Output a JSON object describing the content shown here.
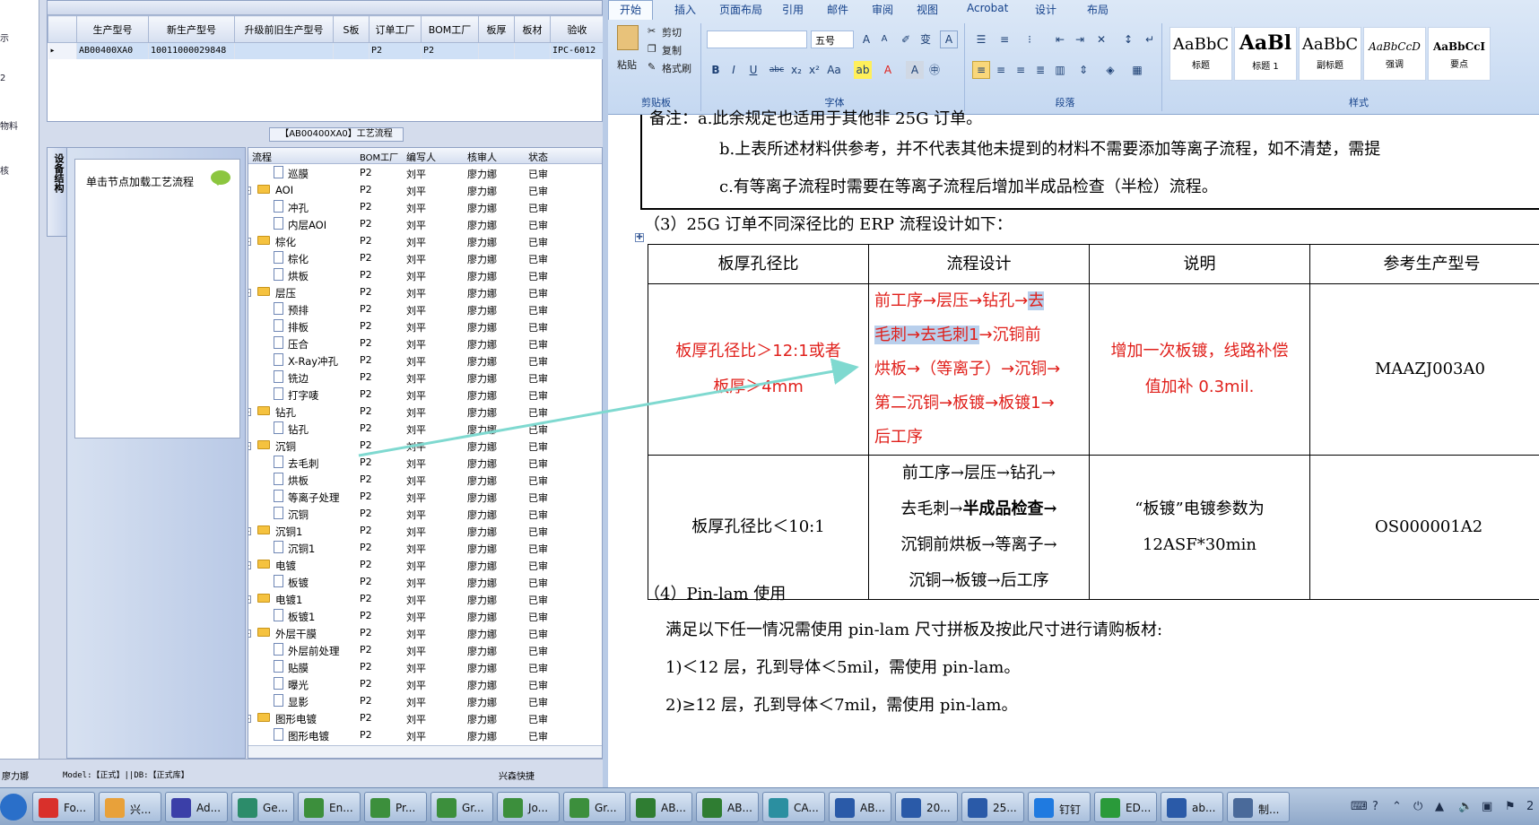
{
  "erp": {
    "sidebar_items": [
      "示",
      "2",
      "物料",
      "核"
    ],
    "grid_columns": [
      "生产型号",
      "新生产型号",
      "升级前旧生产型号",
      "S板",
      "订单工厂",
      "BOM工厂",
      "板厚",
      "板材",
      "验收"
    ],
    "grid_row": [
      "AB00400XA0",
      "10011000029848",
      "",
      "",
      "P2",
      "P2",
      "",
      "",
      "IPC-6012"
    ],
    "flow_caption": "【AB00400XA0】工艺流程",
    "vertical_tab": "设备结构",
    "node_hint": "单击节点加载工艺流程",
    "tree_columns": [
      "流程",
      "BOM工厂",
      "编写人",
      "核审人",
      "状态"
    ],
    "tree_rows": [
      {
        "name": "巡膜",
        "level": 1,
        "factory": "P2",
        "author": "刘平",
        "reviewer": "廖力娜",
        "status": "已审"
      },
      {
        "name": "AOI",
        "level": 0,
        "factory": "P2",
        "author": "刘平",
        "reviewer": "廖力娜",
        "status": "已审"
      },
      {
        "name": "冲孔",
        "level": 1,
        "factory": "P2",
        "author": "刘平",
        "reviewer": "廖力娜",
        "status": "已审"
      },
      {
        "name": "内层AOI",
        "level": 1,
        "factory": "P2",
        "author": "刘平",
        "reviewer": "廖力娜",
        "status": "已审"
      },
      {
        "name": "棕化",
        "level": 0,
        "factory": "P2",
        "author": "刘平",
        "reviewer": "廖力娜",
        "status": "已审"
      },
      {
        "name": "棕化",
        "level": 1,
        "factory": "P2",
        "author": "刘平",
        "reviewer": "廖力娜",
        "status": "已审"
      },
      {
        "name": "烘板",
        "level": 1,
        "factory": "P2",
        "author": "刘平",
        "reviewer": "廖力娜",
        "status": "已审"
      },
      {
        "name": "层压",
        "level": 0,
        "factory": "P2",
        "author": "刘平",
        "reviewer": "廖力娜",
        "status": "已审"
      },
      {
        "name": "预排",
        "level": 1,
        "factory": "P2",
        "author": "刘平",
        "reviewer": "廖力娜",
        "status": "已审"
      },
      {
        "name": "排板",
        "level": 1,
        "factory": "P2",
        "author": "刘平",
        "reviewer": "廖力娜",
        "status": "已审"
      },
      {
        "name": "压合",
        "level": 1,
        "factory": "P2",
        "author": "刘平",
        "reviewer": "廖力娜",
        "status": "已审"
      },
      {
        "name": "X-Ray冲孔",
        "level": 1,
        "factory": "P2",
        "author": "刘平",
        "reviewer": "廖力娜",
        "status": "已审"
      },
      {
        "name": "铣边",
        "level": 1,
        "factory": "P2",
        "author": "刘平",
        "reviewer": "廖力娜",
        "status": "已审"
      },
      {
        "name": "打字唛",
        "level": 1,
        "factory": "P2",
        "author": "刘平",
        "reviewer": "廖力娜",
        "status": "已审"
      },
      {
        "name": "钻孔",
        "level": 0,
        "factory": "P2",
        "author": "刘平",
        "reviewer": "廖力娜",
        "status": "已审"
      },
      {
        "name": "钻孔",
        "level": 1,
        "factory": "P2",
        "author": "刘平",
        "reviewer": "廖力娜",
        "status": "已审"
      },
      {
        "name": "沉铜",
        "level": 0,
        "factory": "P2",
        "author": "刘平",
        "reviewer": "廖力娜",
        "status": "已审"
      },
      {
        "name": "去毛刺",
        "level": 1,
        "factory": "P2",
        "author": "刘平",
        "reviewer": "廖力娜",
        "status": "已审"
      },
      {
        "name": "烘板",
        "level": 1,
        "factory": "P2",
        "author": "刘平",
        "reviewer": "廖力娜",
        "status": "已审"
      },
      {
        "name": "等离子处理",
        "level": 1,
        "factory": "P2",
        "author": "刘平",
        "reviewer": "廖力娜",
        "status": "已审"
      },
      {
        "name": "沉铜",
        "level": 1,
        "factory": "P2",
        "author": "刘平",
        "reviewer": "廖力娜",
        "status": "已审"
      },
      {
        "name": "沉铜1",
        "level": 0,
        "factory": "P2",
        "author": "刘平",
        "reviewer": "廖力娜",
        "status": "已审"
      },
      {
        "name": "沉铜1",
        "level": 1,
        "factory": "P2",
        "author": "刘平",
        "reviewer": "廖力娜",
        "status": "已审"
      },
      {
        "name": "电镀",
        "level": 0,
        "factory": "P2",
        "author": "刘平",
        "reviewer": "廖力娜",
        "status": "已审"
      },
      {
        "name": "板镀",
        "level": 1,
        "factory": "P2",
        "author": "刘平",
        "reviewer": "廖力娜",
        "status": "已审"
      },
      {
        "name": "电镀1",
        "level": 0,
        "factory": "P2",
        "author": "刘平",
        "reviewer": "廖力娜",
        "status": "已审"
      },
      {
        "name": "板镀1",
        "level": 1,
        "factory": "P2",
        "author": "刘平",
        "reviewer": "廖力娜",
        "status": "已审"
      },
      {
        "name": "外层干膜",
        "level": 0,
        "factory": "P2",
        "author": "刘平",
        "reviewer": "廖力娜",
        "status": "已审"
      },
      {
        "name": "外层前处理",
        "level": 1,
        "factory": "P2",
        "author": "刘平",
        "reviewer": "廖力娜",
        "status": "已审"
      },
      {
        "name": "贴膜",
        "level": 1,
        "factory": "P2",
        "author": "刘平",
        "reviewer": "廖力娜",
        "status": "已审"
      },
      {
        "name": "曝光",
        "level": 1,
        "factory": "P2",
        "author": "刘平",
        "reviewer": "廖力娜",
        "status": "已审"
      },
      {
        "name": "显影",
        "level": 1,
        "factory": "P2",
        "author": "刘平",
        "reviewer": "廖力娜",
        "status": "已审"
      },
      {
        "name": "图形电镀",
        "level": 0,
        "factory": "P2",
        "author": "刘平",
        "reviewer": "廖力娜",
        "status": "已审"
      },
      {
        "name": "图形电镀",
        "level": 1,
        "factory": "P2",
        "author": "刘平",
        "reviewer": "廖力娜",
        "status": "已审"
      }
    ],
    "status_left": "廖力娜",
    "status_model": "Model:【正式】||DB:【正式库】",
    "status_company": "兴森快捷"
  },
  "word": {
    "tabs": [
      "开始",
      "插入",
      "页面布局",
      "引用",
      "邮件",
      "审阅",
      "视图",
      "Acrobat",
      "设计",
      "布局"
    ],
    "clipboard": {
      "paste": "粘贴",
      "cut": "剪切",
      "copy": "复制",
      "format_painter": "格式刷",
      "group": "剪贴板"
    },
    "font": {
      "size": "五号",
      "group": "字体"
    },
    "paragraph_group": "段落",
    "styles_group": "样式",
    "styles": [
      {
        "sample": "AaBbC",
        "name": "标题"
      },
      {
        "sample": "AaBl",
        "name": "标题 1"
      },
      {
        "sample": "AaBbC",
        "name": "副标题"
      },
      {
        "sample": "AaBbCcD",
        "name": "强调"
      },
      {
        "sample": "AaBbCcI",
        "name": "要点"
      }
    ],
    "doc": {
      "note_a": "备注：a.此余规定也适用于其他非 25G 订单。",
      "note_b": "b.上表所述材料供参考，并不代表其他未提到的材料不需要添加等离子流程，如不清楚，需提",
      "note_c": "c.有等离子流程时需要在等离子流程后增加半成品检查（半检）流程。",
      "heading3": "（3）25G 订单不同深径比的 ERP 流程设计如下：",
      "table_headers": [
        "板厚孔径比",
        "流程设计",
        "说明",
        "参考生产型号"
      ],
      "row1": {
        "ratio_line1": "板厚孔径比＞12:1或者",
        "ratio_line2": "板厚＞4mm",
        "flow_a": "前工序→层压→钻孔→",
        "flow_hl1": "去",
        "flow_hl2": "毛刺→去毛刺1",
        "flow_b": "→沉铜前",
        "flow_c": "烘板→（等离子）→沉铜→",
        "flow_d": "第二沉铜→板镀→板镀1→",
        "flow_e": "后工序",
        "desc_line1": "增加一次板镀，线路补偿",
        "desc_line2": "值加补 0.3mil.",
        "ref": "MAAZJ003A0"
      },
      "row2": {
        "ratio": "板厚孔径比＜10:1",
        "flow_a": "前工序→层压→钻孔→",
        "flow_b1": "去毛刺→",
        "flow_b2": "半成品检查→",
        "flow_c": "沉铜前烘板→等离子→",
        "flow_d": "沉铜→板镀→后工序",
        "desc_line1": "“板镀”电镀参数为",
        "desc_line2": "12ASF*30min",
        "ref": "OS000001A2"
      },
      "heading4": "（4）Pin-lam 使用",
      "pin_intro": "满足以下任一情况需使用 pin-lam 尺寸拼板及按此尺寸进行请购板材:",
      "pin_1": "1)＜12 层，孔到导体＜5mil，需使用 pin-lam。",
      "pin_2": "2)≥12 层，孔到导体＜7mil，需使用 pin-lam。"
    }
  },
  "taskbar": {
    "items": [
      {
        "label": "Fo...",
        "color": "#d9302b"
      },
      {
        "label": "兴...",
        "color": "#e8a13a"
      },
      {
        "label": "Ad...",
        "color": "#3b3fa8"
      },
      {
        "label": "Ge...",
        "color": "#2c8c6a"
      },
      {
        "label": "En...",
        "color": "#3c8f3c"
      },
      {
        "label": "Pr...",
        "color": "#3c8f3c"
      },
      {
        "label": "Gr...",
        "color": "#3c8f3c"
      },
      {
        "label": "Jo...",
        "color": "#3c8f3c"
      },
      {
        "label": "Gr...",
        "color": "#3c8f3c"
      },
      {
        "label": "AB...",
        "color": "#2f7d32"
      },
      {
        "label": "AB...",
        "color": "#2f7d32"
      },
      {
        "label": "CA...",
        "color": "#2b8fa0"
      },
      {
        "label": "AB...",
        "color": "#2a5aa8"
      },
      {
        "label": "20...",
        "color": "#2a5aa8"
      },
      {
        "label": "25...",
        "color": "#2a5aa8"
      },
      {
        "label": "钉钉",
        "color": "#1f7ae0"
      },
      {
        "label": "ED...",
        "color": "#2a9a3a"
      },
      {
        "label": "ab...",
        "color": "#2a5aa8"
      },
      {
        "label": "制...",
        "color": "#4a6a9a"
      }
    ],
    "tray_time": "2"
  }
}
